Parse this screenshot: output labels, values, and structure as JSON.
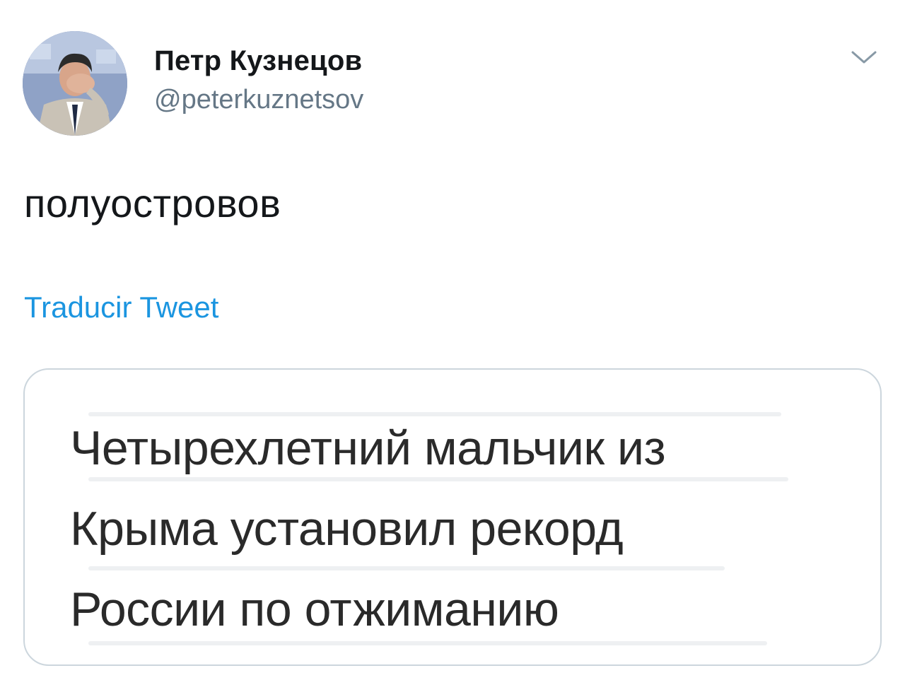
{
  "author": {
    "display_name": "Петр Кузнецов",
    "handle": "@peterkuznetsov"
  },
  "tweet": {
    "text": "полуостровов",
    "translate_label": "Traducir Tweet"
  },
  "media": {
    "lines": [
      "Четырехлетний мальчик из",
      "Крыма установил рекорд",
      "России по отжиманию"
    ]
  },
  "icons": {
    "menu": "chevron-down-icon",
    "avatar": "avatar"
  },
  "colors": {
    "name": "#14171a",
    "handle": "#657786",
    "link": "#1b95e0",
    "card_border": "#ccd6dd"
  }
}
